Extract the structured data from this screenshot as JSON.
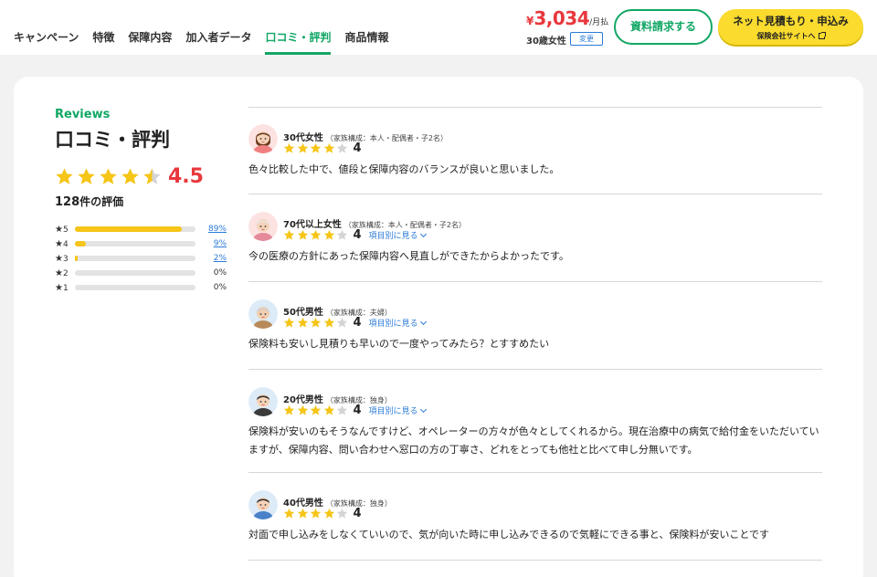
{
  "header": {
    "tabs": [
      "キャンペーン",
      "特徴",
      "保障内容",
      "加入者データ",
      "口コミ・評判",
      "商品情報"
    ],
    "active_tab": "口コミ・評判",
    "price": {
      "currency": "¥",
      "amount": "3,034",
      "per": "/月払"
    },
    "age_gender": "30歳女性",
    "change_label": "変更",
    "request_label": "資料請求する",
    "apply_label": "ネット見積もり・申込み",
    "apply_sub": "保険会社サイトへ"
  },
  "summary": {
    "eyebrow": "Reviews",
    "title": "口コミ・評判",
    "average": "4.5",
    "average_value": 4.5,
    "count": "128",
    "count_suffix": "件の評価",
    "distribution": [
      {
        "label": "5",
        "pct": "89%",
        "fraction": 0.89,
        "link": true
      },
      {
        "label": "4",
        "pct": "9%",
        "fraction": 0.09,
        "link": true
      },
      {
        "label": "3",
        "pct": "2%",
        "fraction": 0.02,
        "link": true
      },
      {
        "label": "2",
        "pct": "0%",
        "fraction": 0,
        "link": false
      },
      {
        "label": "1",
        "pct": "0%",
        "fraction": 0,
        "link": false
      }
    ]
  },
  "reviews": [
    {
      "who": "30代女性",
      "family": "（家族構成：本人・配偶者・子2名）",
      "rating": "4",
      "rating_value": 4,
      "detail_label": "",
      "text": "色々比較した中で、値段と保障内容のバランスが良いと思いました。",
      "avatar": "woman-30s-avatar"
    },
    {
      "who": "70代以上女性",
      "family": "（家族構成：本人・配偶者・子2名）",
      "rating": "4",
      "rating_value": 4,
      "detail_label": "項目別に見る",
      "text": "今の医療の方針にあった保障内容へ見直しができたからよかったです。",
      "avatar": "woman-70s-avatar"
    },
    {
      "who": "50代男性",
      "family": "（家族構成：夫婦）",
      "rating": "4",
      "rating_value": 4,
      "detail_label": "項目別に見る",
      "text": "保険料も安いし見積りも早いので一度やってみたら？とすすめたい",
      "avatar": "man-50s-avatar"
    },
    {
      "who": "20代男性",
      "family": "（家族構成：独身）",
      "rating": "4",
      "rating_value": 4,
      "detail_label": "項目別に見る",
      "text": "保険料が安いのもそうなんですけど、オペレーターの方々が色々としてくれるから。現在治療中の病気で給付金をいただいていますが、保障内容、問い合わせへ窓口の方の丁寧さ、どれをとっても他社と比べて申し分無いです。",
      "avatar": "man-20s-avatar"
    },
    {
      "who": "40代男性",
      "family": "（家族構成：独身）",
      "rating": "4",
      "rating_value": 4,
      "detail_label": "",
      "text": "対面で申し込みをしなくていいので、気が向いた時に申し込みできるので気軽にできる事と、保険料が安いことです",
      "avatar": "man-40s-avatar"
    }
  ],
  "colors": {
    "brand": "#11a765",
    "price": "#e8383d",
    "star": "#f5c518",
    "star_empty": "#d4d4d4",
    "link": "#2b7bd8",
    "cta": "#fadb2e"
  }
}
